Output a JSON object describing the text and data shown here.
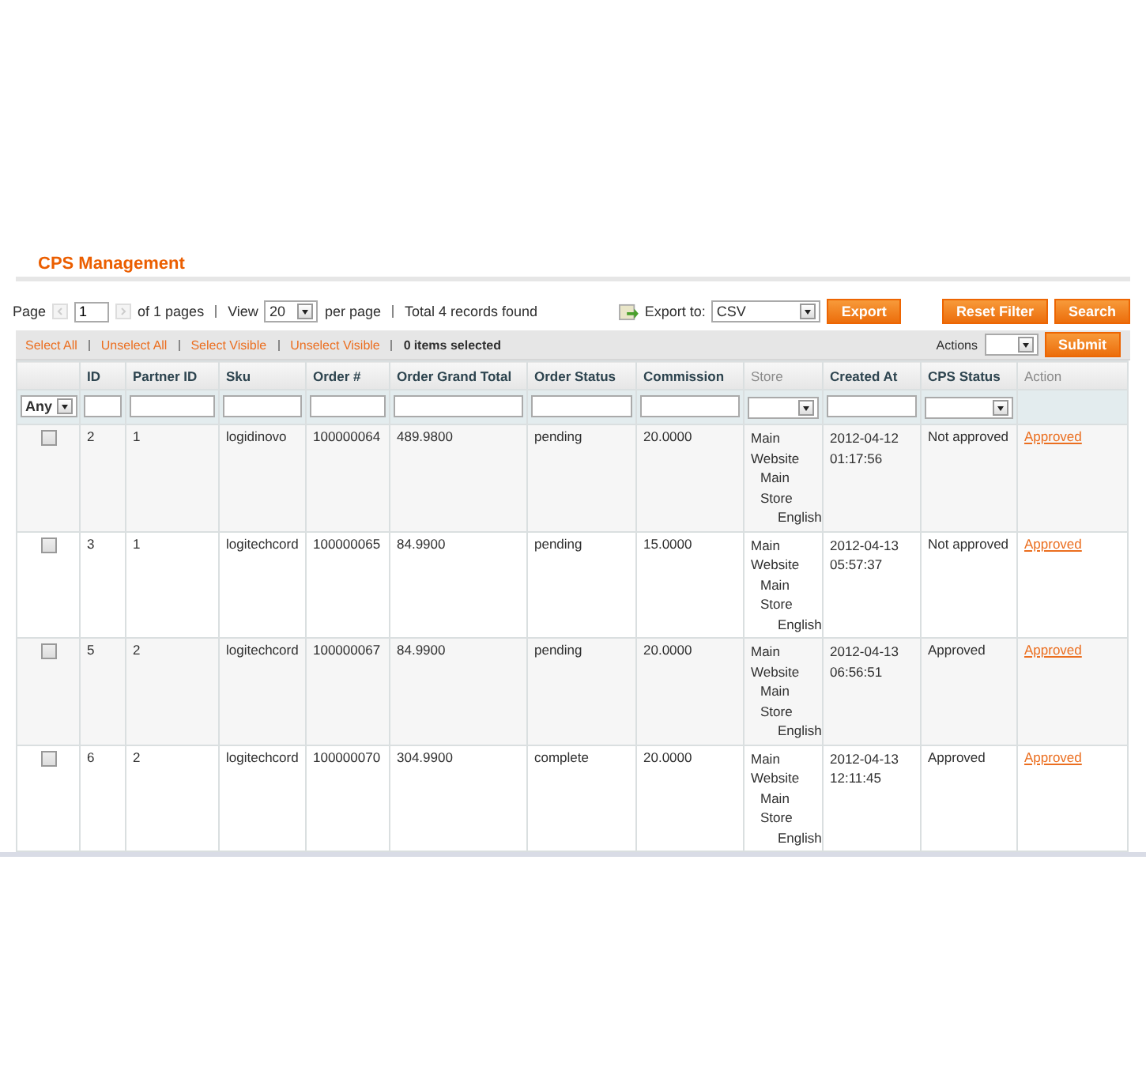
{
  "page_title": "CPS Management",
  "pager": {
    "page_label": "Page",
    "page_value": "1",
    "of_pages": "of 1 pages",
    "view_label": "View",
    "view_value": "20",
    "per_page": "per page",
    "total": "Total 4 records found"
  },
  "export": {
    "label": "Export to:",
    "value": "CSV",
    "button": "Export"
  },
  "buttons": [
    "Reset Filter",
    "Search"
  ],
  "massaction": {
    "links": [
      "Select All",
      "Unselect All",
      "Select Visible",
      "Unselect Visible"
    ],
    "count": "0",
    "count_label": "items selected",
    "actions_label": "Actions",
    "submit": "Submit"
  },
  "filter_any": "Any",
  "columns": [
    {
      "label": "ID",
      "sortable": true,
      "kind": "text"
    },
    {
      "label": "Partner ID",
      "sortable": true,
      "kind": "text"
    },
    {
      "label": "Sku",
      "sortable": true,
      "kind": "text"
    },
    {
      "label": "Order #",
      "sortable": true,
      "kind": "text"
    },
    {
      "label": "Order Grand Total",
      "sortable": true,
      "kind": "text"
    },
    {
      "label": "Order Status",
      "sortable": true,
      "kind": "text"
    },
    {
      "label": "Commission",
      "sortable": true,
      "kind": "text"
    },
    {
      "label": "Store",
      "sortable": false,
      "kind": "select"
    },
    {
      "label": "Created At",
      "sortable": true,
      "kind": "text"
    },
    {
      "label": "CPS Status",
      "sortable": true,
      "kind": "select"
    },
    {
      "label": "Action",
      "sortable": false,
      "kind": "none"
    }
  ],
  "rows": [
    {
      "checked": false,
      "id": "2",
      "partner_id": "1",
      "sku": "logidinovo",
      "order": "100000064",
      "total": "489.9800",
      "status": "pending",
      "commission": "20.0000",
      "store": [
        "Main Website",
        "Main Store",
        "English"
      ],
      "created": [
        "2012-04-12",
        "01:17:56"
      ],
      "cps_status": "Not approved",
      "action": "Approved"
    },
    {
      "checked": false,
      "id": "3",
      "partner_id": "1",
      "sku": "logitechcord",
      "order": "100000065",
      "total": "84.9900",
      "status": "pending",
      "commission": "15.0000",
      "store": [
        "Main Website",
        "Main Store",
        "English"
      ],
      "created": [
        "2012-04-13",
        "05:57:37"
      ],
      "cps_status": "Not approved",
      "action": "Approved"
    },
    {
      "checked": false,
      "id": "5",
      "partner_id": "2",
      "sku": "logitechcord",
      "order": "100000067",
      "total": "84.9900",
      "status": "pending",
      "commission": "20.0000",
      "store": [
        "Main Website",
        "Main Store",
        "English"
      ],
      "created": [
        "2012-04-13",
        "06:56:51"
      ],
      "cps_status": "Approved",
      "action": "Approved"
    },
    {
      "checked": false,
      "id": "6",
      "partner_id": "2",
      "sku": "logitechcord",
      "order": "100000070",
      "total": "304.9900",
      "status": "complete",
      "commission": "20.0000",
      "store": [
        "Main Website",
        "Main Store",
        "English"
      ],
      "created": [
        "2012-04-13",
        "12:11:45"
      ],
      "cps_status": "Approved",
      "action": "Approved"
    }
  ]
}
